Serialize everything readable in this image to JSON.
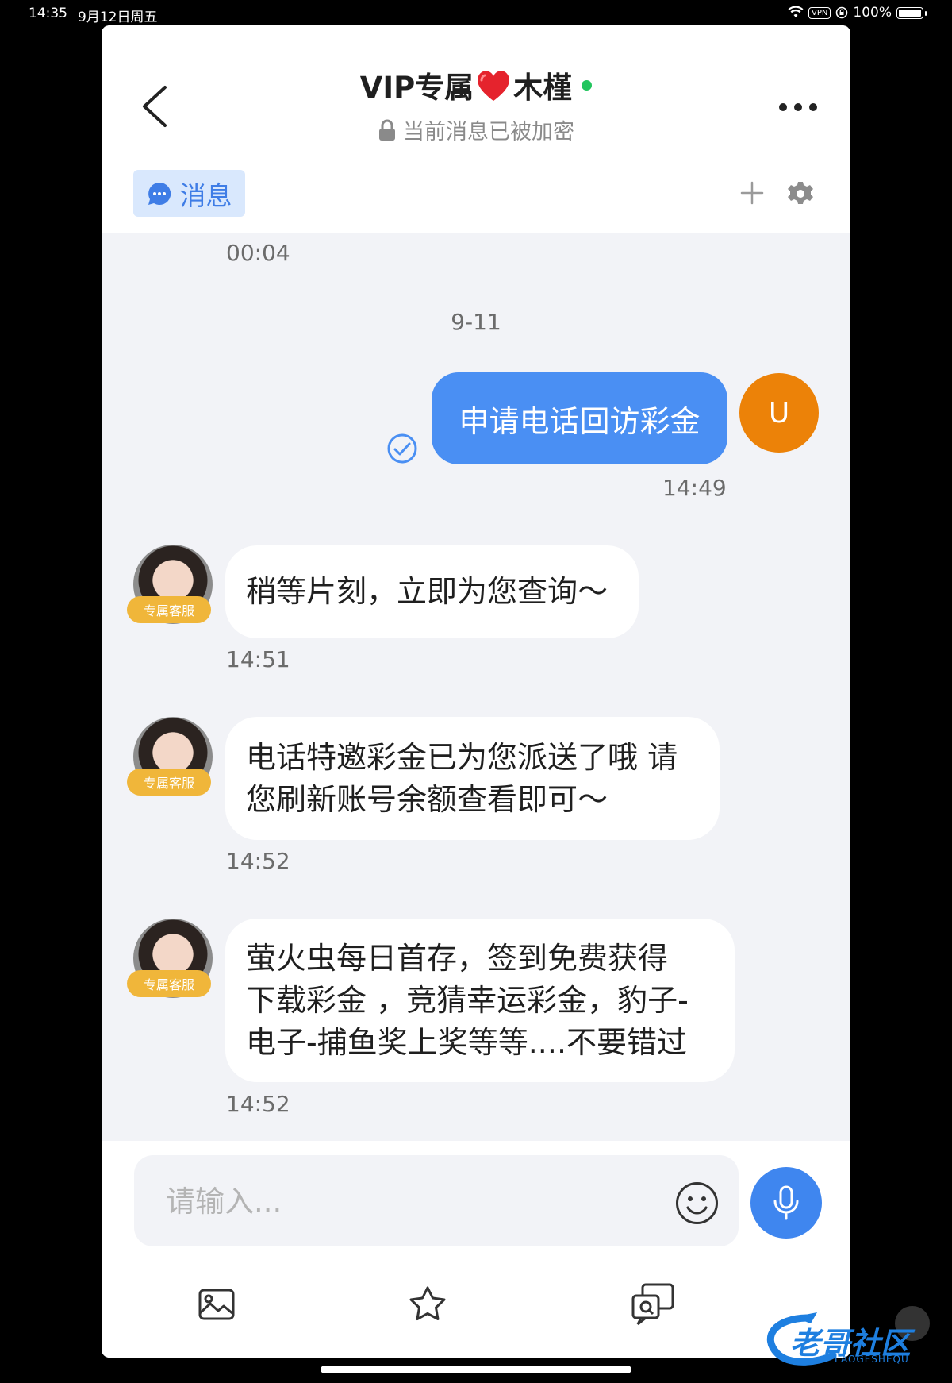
{
  "status_bar": {
    "time": "14:35",
    "date": "9月12日周五",
    "vpn": "VPN",
    "battery": "100%"
  },
  "header": {
    "title": "VIP专属",
    "title_emoji": "❤️",
    "title_name": "木槿",
    "subtitle": "当前消息已被加密",
    "tab_label": "消息"
  },
  "messages": {
    "first_time": "00:04",
    "date_divider": "9-11",
    "outgoing": {
      "text": "申请电话回访彩金",
      "time": "14:49",
      "avatar_letter": "U"
    },
    "incoming": [
      {
        "badge": "专属客服",
        "lines": [
          "稍等片刻，立即为您查询～"
        ],
        "time": "14:51"
      },
      {
        "badge": "专属客服",
        "lines": [
          "电话特邀彩金已为您派送了哦 请",
          "您刷新账号余额查看即可～"
        ],
        "time": "14:52"
      },
      {
        "badge": "专属客服",
        "lines": [
          "萤火虫每日首存，签到免费获得",
          "下载彩金 ，竞猜幸运彩金，豹子-",
          "电子-捕鱼奖上奖等等....不要错过"
        ],
        "time": "14:52"
      }
    ]
  },
  "composer": {
    "placeholder": "请输入..."
  },
  "watermark": {
    "text": "老哥社区",
    "subtext": "LAOGESHEQU"
  },
  "icons": [
    "back-icon",
    "more-icon",
    "chat-bubble-icon",
    "plus-icon",
    "gear-icon",
    "check-icon",
    "emoji-icon",
    "mic-icon",
    "image-icon",
    "star-icon",
    "quick-reply-icon",
    "lock-icon"
  ]
}
